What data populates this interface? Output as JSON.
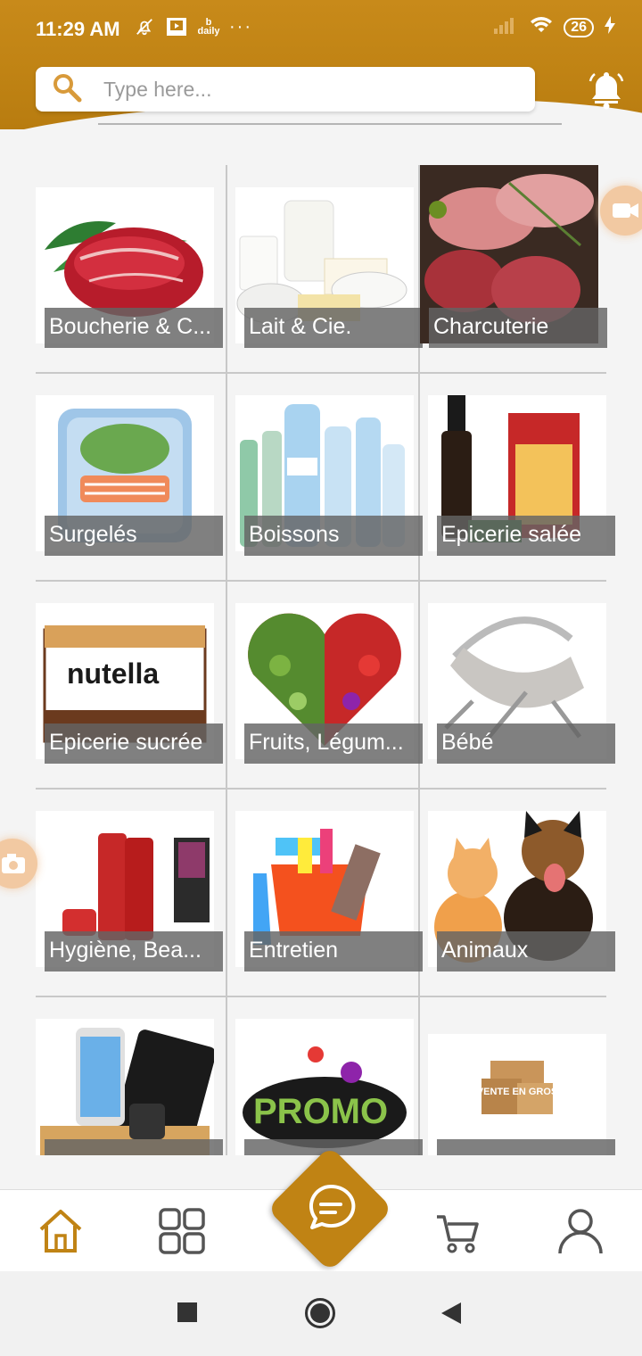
{
  "status_bar": {
    "time": "11:29 AM",
    "battery": "26",
    "icons": [
      "mute-bell-icon",
      "tv-icon",
      "bb-daily-icon",
      "more-dots-icon",
      "signal-icon",
      "wifi-icon",
      "battery-icon",
      "charging-icon"
    ]
  },
  "search": {
    "placeholder": "Type here..."
  },
  "colors": {
    "brand": "#c08314",
    "caption_bg": "#646464",
    "nav_active": "#c08314"
  },
  "categories": [
    {
      "label": "Boucherie & C...",
      "icon": "meat-image"
    },
    {
      "label": "Lait & Cie.",
      "icon": "dairy-image"
    },
    {
      "label": "Charcuterie",
      "icon": "cold-cuts-image"
    },
    {
      "label": "Surgelés",
      "icon": "frozen-image"
    },
    {
      "label": "Boissons",
      "icon": "water-bottles-image"
    },
    {
      "label": "Epicerie salée",
      "icon": "pasta-image"
    },
    {
      "label": "Epicerie sucrée",
      "icon": "nutella-image"
    },
    {
      "label": "Fruits, Légum...",
      "icon": "vegetable-heart-image"
    },
    {
      "label": "Bébé",
      "icon": "baby-bouncer-image"
    },
    {
      "label": "Hygiène, Bea...",
      "icon": "shampoo-image"
    },
    {
      "label": "Entretien",
      "icon": "cleaning-bucket-image"
    },
    {
      "label": "Animaux",
      "icon": "cat-dog-image"
    },
    {
      "label": "",
      "icon": "phone-stand-image"
    },
    {
      "label": "",
      "icon": "promo-image",
      "text": "PROMO"
    },
    {
      "label": "",
      "icon": "boxes-image",
      "text": "VENTE EN GROS"
    }
  ],
  "bottom_nav": {
    "items": [
      "home-icon",
      "categories-grid-icon",
      "chat-icon",
      "cart-icon",
      "profile-icon"
    ]
  }
}
